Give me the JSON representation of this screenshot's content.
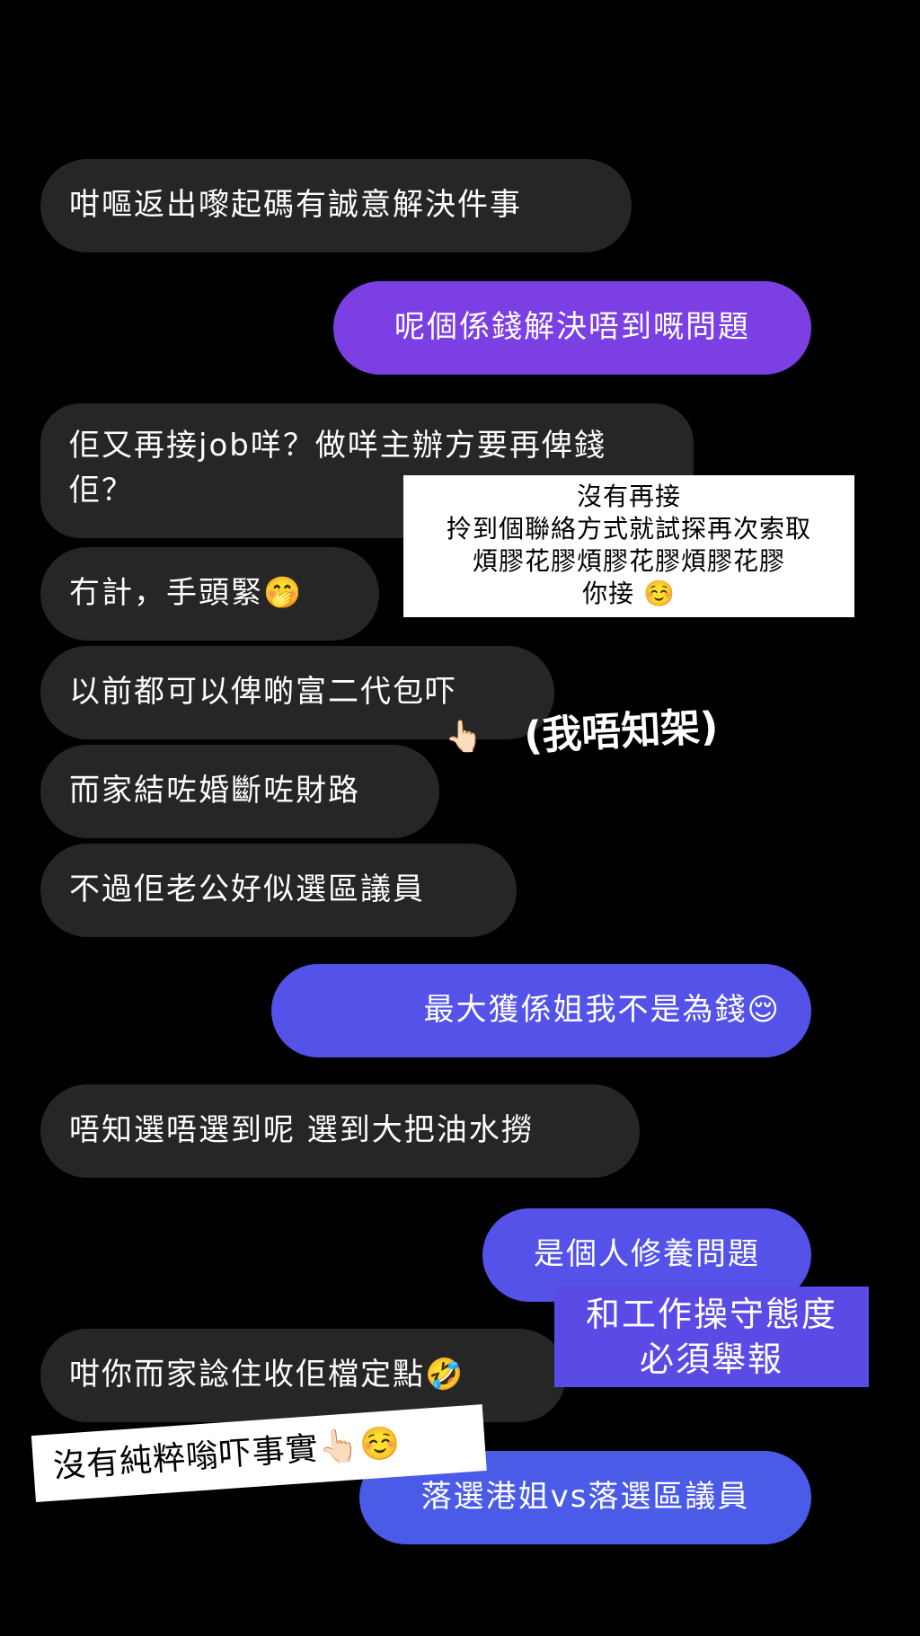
{
  "colors": {
    "background": "#000000",
    "received_bubble": "#262626",
    "sent_purple": "#7b3fe4",
    "sent_indigo": "#5452e8",
    "sent_blue": "#4a5be8",
    "sticker_purple": "#5a4be6"
  },
  "messages": [
    {
      "side": "received",
      "text": "咁嘔返出嚟起碼有誠意解決件事"
    },
    {
      "side": "sent",
      "text": "呢個係錢解決唔到嘅問題"
    },
    {
      "side": "received",
      "text": "佢又再接job咩？做咩主辦方要再俾錢佢？"
    },
    {
      "side": "received",
      "text": "冇計，手頭緊",
      "emoji": "🤭"
    },
    {
      "side": "received",
      "text": "以前都可以俾啲富二代包吓"
    },
    {
      "side": "received",
      "text": "而家結咗婚斷咗財路"
    },
    {
      "side": "received",
      "text": "不過佢老公好似選區議員"
    },
    {
      "side": "sent",
      "text": "最大獲係姐我不是為錢",
      "emoji": "😌"
    },
    {
      "side": "received",
      "text": "唔知選唔選到呢 選到大把油水撈"
    },
    {
      "side": "sent",
      "text": "是個人修養問題"
    },
    {
      "side": "received",
      "text": "咁你而家諗住收佢檔定點",
      "emoji": "🤣"
    },
    {
      "side": "sent",
      "text": "落選港姐vs落選區議員"
    }
  ],
  "overlays": {
    "white_note": {
      "lines": [
        "沒有再接",
        "拎到個聯絡方式就試探再次索取",
        "煩膠花膠煩膠花膠煩膠花膠"
      ],
      "last_line": "你接",
      "emoji": "☺️"
    },
    "handwritten": "(我唔知架)",
    "pointer_emoji": "👆🏻",
    "purple_sticker": [
      "和工作操守態度",
      "必須舉報"
    ],
    "tilted_note": {
      "text": "沒有純粹嗡吓事實",
      "emoji": "👆🏻☺️"
    }
  }
}
